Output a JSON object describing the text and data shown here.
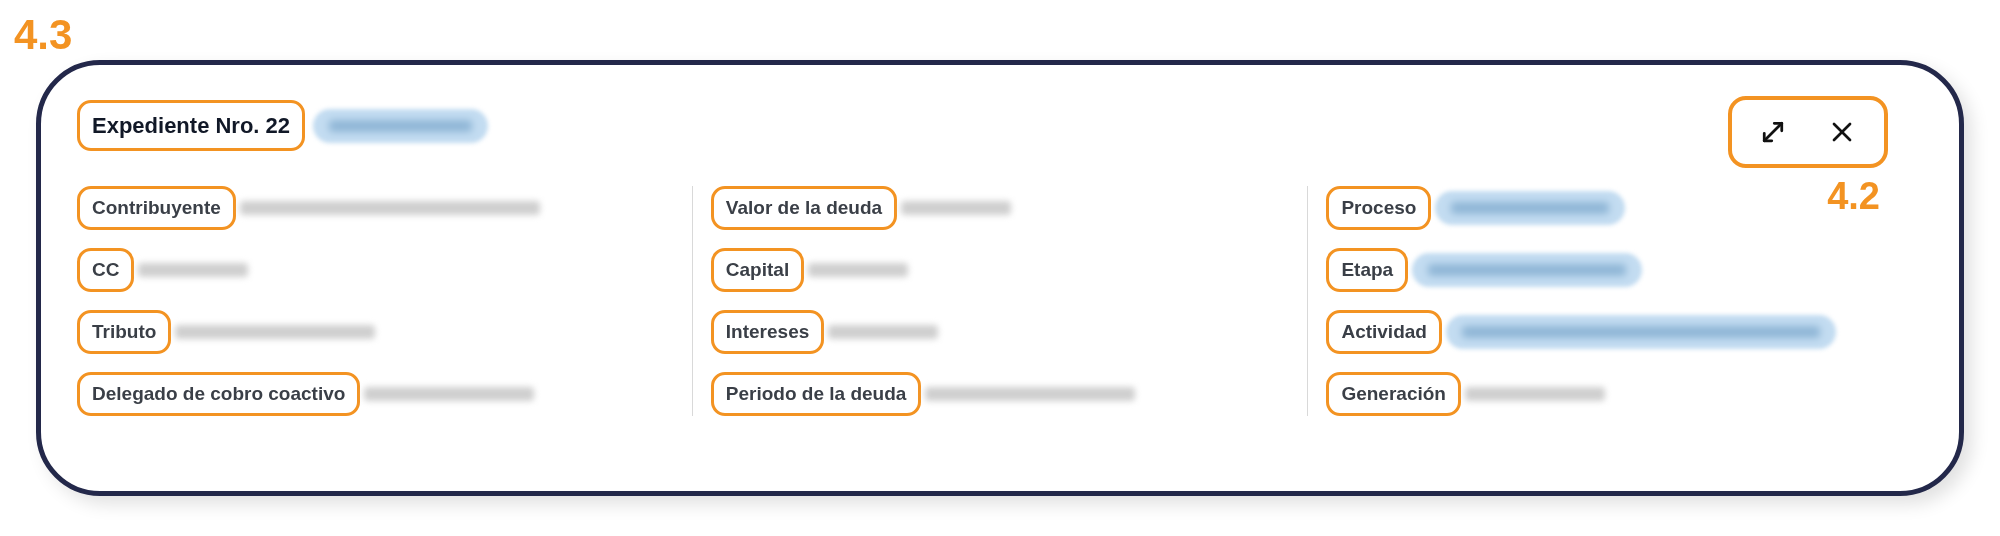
{
  "callouts": {
    "card": "4.3",
    "actions": "4.2"
  },
  "header": {
    "title": "Expediente Nro. 22",
    "status": {
      "kind": "pill"
    }
  },
  "columns": [
    {
      "fields": [
        {
          "label": "Contribuyente",
          "value": {
            "kind": "text"
          }
        },
        {
          "label": "CC",
          "value": {
            "kind": "text"
          }
        },
        {
          "label": "Tributo",
          "value": {
            "kind": "text"
          }
        },
        {
          "label": "Delegado de cobro coactivo",
          "value": {
            "kind": "text"
          }
        }
      ]
    },
    {
      "fields": [
        {
          "label": "Valor de la deuda",
          "value": {
            "kind": "text"
          }
        },
        {
          "label": "Capital",
          "value": {
            "kind": "text"
          }
        },
        {
          "label": "Intereses",
          "value": {
            "kind": "text"
          }
        },
        {
          "label": "Periodo de la deuda",
          "value": {
            "kind": "text"
          }
        }
      ]
    },
    {
      "fields": [
        {
          "label": "Proceso",
          "value": {
            "kind": "pill"
          }
        },
        {
          "label": "Etapa",
          "value": {
            "kind": "pill"
          }
        },
        {
          "label": "Actividad",
          "value": {
            "kind": "pill"
          }
        },
        {
          "label": "Generación",
          "value": {
            "kind": "text"
          }
        }
      ]
    }
  ]
}
